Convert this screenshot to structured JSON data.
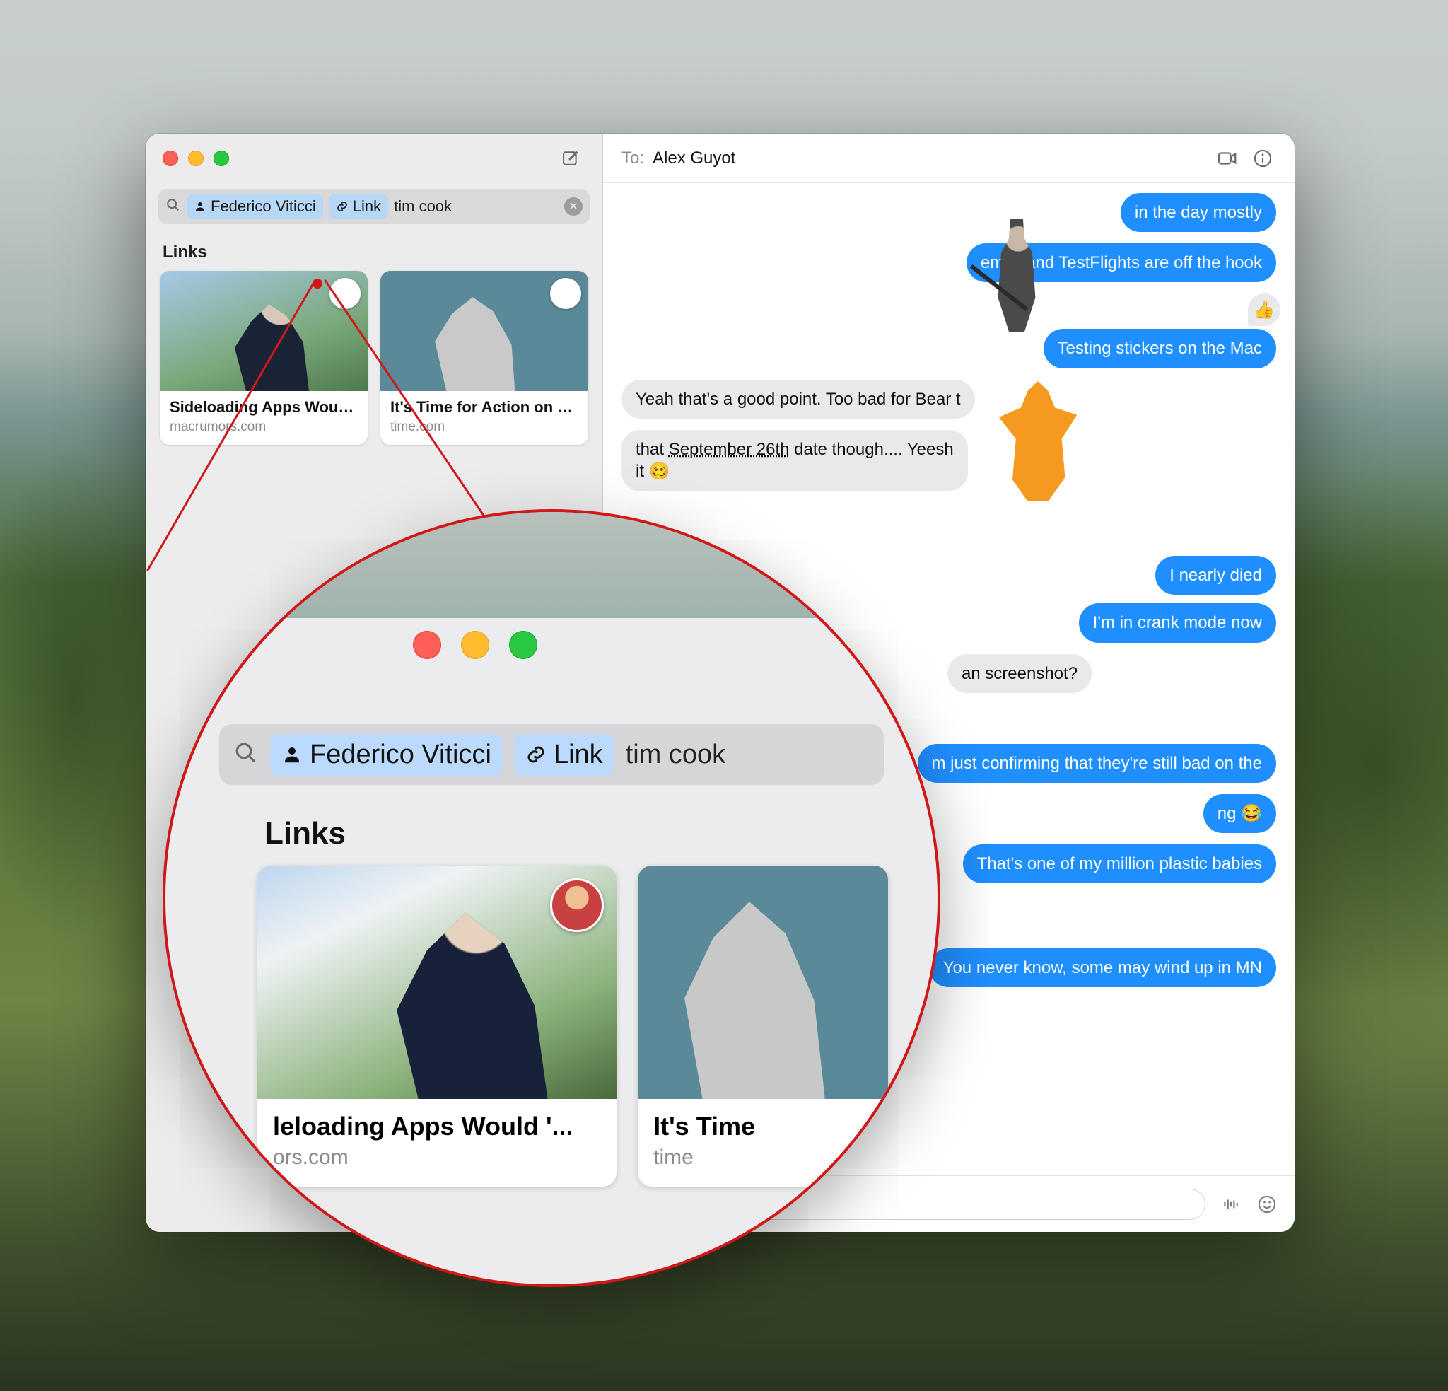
{
  "window": {
    "traffic": {
      "close": "close",
      "minimize": "minimize",
      "zoom": "zoom"
    }
  },
  "sidebar": {
    "search": {
      "token_person": "Federico Viticci",
      "token_kind": "Link",
      "query": "tim cook"
    },
    "section_label": "Links",
    "cards": [
      {
        "title": "Sideloading Apps Would '...",
        "domain": "macrumors.com"
      },
      {
        "title": "It's Time for Action on Pri...",
        "domain": "time.com"
      }
    ]
  },
  "header": {
    "to_label": "To:",
    "to_name": "Alex Guyot"
  },
  "messages": {
    "m1": "in the day mostly",
    "m2": "email and TestFlights are off the hook",
    "m3_tapback": "👍",
    "m3": "Testing stickers on the Mac",
    "m4": "Yeah that's a good point. Too bad for Bear t",
    "m5a": "that ",
    "m5b": "September 26th",
    "m5c": " date though.... Yeesh",
    "m5d": "it 🥴",
    "m6": "I nearly died",
    "m7": "I'm in crank mode now",
    "m8": "an screenshot?",
    "m9": "m just confirming that they're still bad on the",
    "m10": "ng 😂",
    "m11": "That's one of my million plastic babies",
    "m12": "You never know, some may wind up in MN"
  },
  "composer": {
    "placeholder": ""
  },
  "lens": {
    "token_person": "Federico Viticci",
    "token_kind": "Link",
    "query": "tim cook",
    "section_label": "Links",
    "cards": [
      {
        "title": "leloading Apps Would '...",
        "domain": "ors.com"
      },
      {
        "title": "It's Time",
        "domain": "time"
      }
    ]
  }
}
